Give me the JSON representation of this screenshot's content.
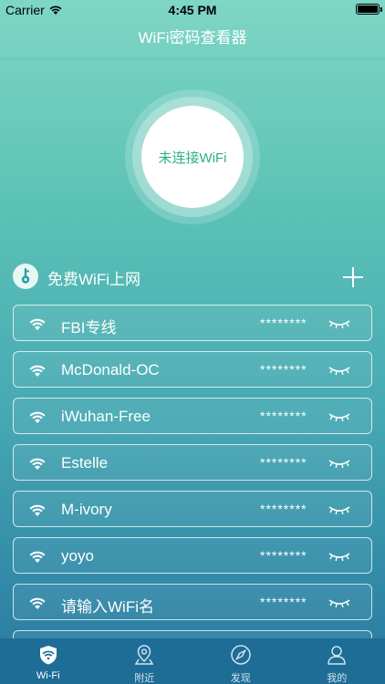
{
  "status_bar": {
    "carrier": "Carrier",
    "time": "4:45 PM"
  },
  "nav": {
    "title": "WiFi密码查看器"
  },
  "connection": {
    "status_text": "未连接WiFi"
  },
  "section": {
    "title": "免费WiFi上网"
  },
  "wifi_list": [
    {
      "name": "FBI专线",
      "password": "********"
    },
    {
      "name": "McDonald-OC",
      "password": "********"
    },
    {
      "name": "iWuhan-Free",
      "password": "********"
    },
    {
      "name": "Estelle",
      "password": "********"
    },
    {
      "name": "M-ivory",
      "password": "********"
    },
    {
      "name": "yoyo",
      "password": "********"
    },
    {
      "name": "请输入WiFi名",
      "password": "********"
    }
  ],
  "tabs": [
    {
      "label": "Wi-Fi",
      "icon": "wifi-shield-icon",
      "active": true
    },
    {
      "label": "附近",
      "icon": "location-pin-icon",
      "active": false
    },
    {
      "label": "发现",
      "icon": "compass-icon",
      "active": false
    },
    {
      "label": "我的",
      "icon": "user-icon",
      "active": false
    }
  ],
  "colors": {
    "accent": "#2fae88",
    "tab_bar": "#1e6d96",
    "gradient_top": "#7fd6c4",
    "gradient_bottom": "#2a79a0"
  }
}
